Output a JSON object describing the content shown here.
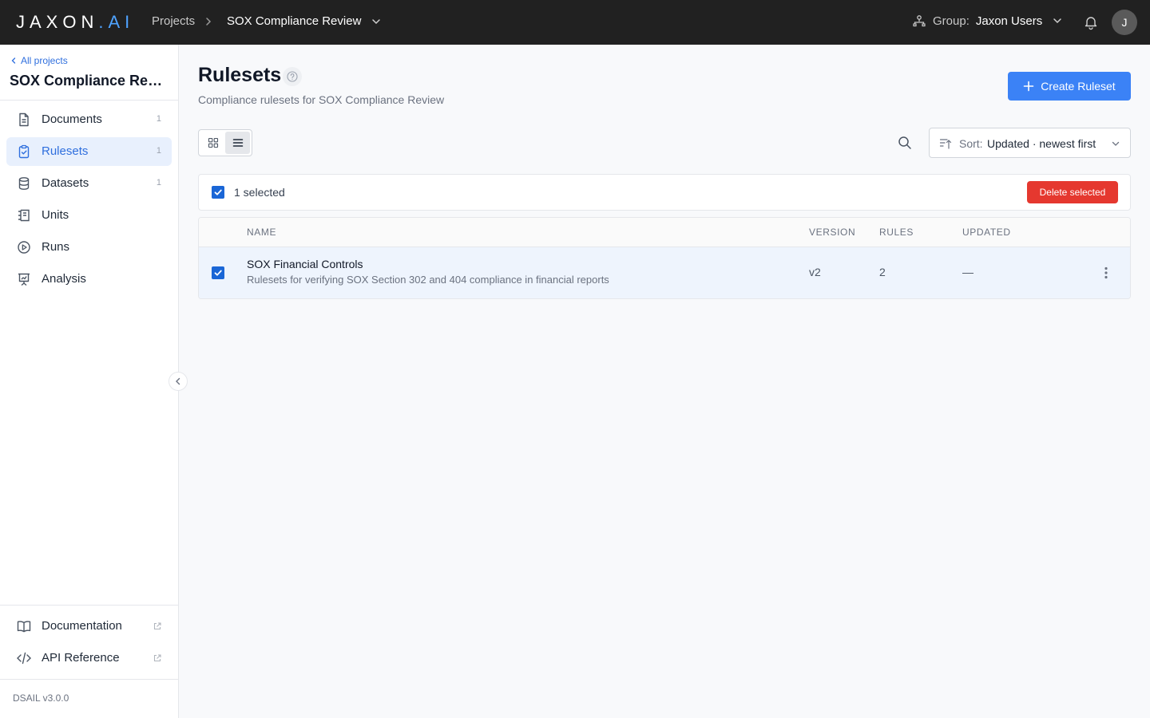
{
  "topbar": {
    "logo_main": "JAXON",
    "logo_dot": ".",
    "logo_ai": "AI",
    "crumb_projects": "Projects",
    "crumb_current": "SOX Compliance Review",
    "group_label": "Group:",
    "group_value": "Jaxon Users",
    "avatar_initial": "J"
  },
  "sidebar": {
    "back_link": "All projects",
    "project_title": "SOX Compliance Review",
    "nav": [
      {
        "label": "Documents",
        "count": "1",
        "icon": "document-icon"
      },
      {
        "label": "Rulesets",
        "count": "1",
        "icon": "clipboard-check-icon",
        "active": true
      },
      {
        "label": "Datasets",
        "count": "1",
        "icon": "database-icon"
      },
      {
        "label": "Units",
        "count": "",
        "icon": "units-icon"
      },
      {
        "label": "Runs",
        "count": "",
        "icon": "play-circle-icon"
      },
      {
        "label": "Analysis",
        "count": "",
        "icon": "presentation-chart-icon"
      }
    ],
    "footer_links": [
      {
        "label": "Documentation",
        "icon": "book-icon"
      },
      {
        "label": "API Reference",
        "icon": "code-icon"
      }
    ],
    "version": "DSAIL v3.0.0"
  },
  "main": {
    "title": "Rulesets",
    "subtitle": "Compliance rulesets for SOX Compliance Review",
    "create_button": "Create Ruleset",
    "sort_label": "Sort:",
    "sort_value": "Updated · newest first",
    "selected_text": "1 selected",
    "delete_button": "Delete selected",
    "columns": {
      "name": "NAME",
      "version": "VERSION",
      "rules": "RULES",
      "updated": "UPDATED"
    },
    "rows": [
      {
        "name": "SOX Financial Controls",
        "description": "Rulesets for verifying SOX Section 302 and 404 compliance in financial reports",
        "version": "v2",
        "rules": "2",
        "updated": "—",
        "selected": true
      }
    ]
  },
  "colors": {
    "accent": "#3b82f6",
    "danger": "#e5382f",
    "topbar": "#212121",
    "active_nav_bg": "#e8f0fd"
  }
}
